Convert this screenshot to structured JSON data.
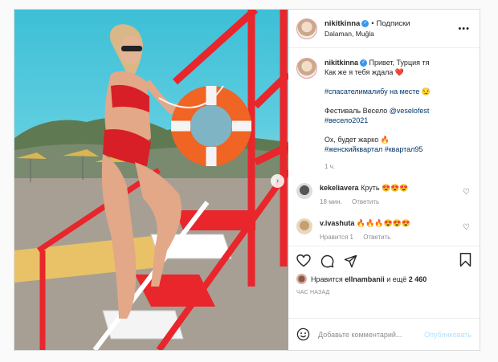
{
  "post": {
    "username": "nikitkinna",
    "follow_sep": "•",
    "follow_label": "Подписки",
    "location": "Dalaman, Muğla",
    "more_icon": "ellipsis-icon",
    "caption": {
      "line1": "Привет, Турция тя",
      "line2": "Как же я тебя ждала",
      "line2_emoji": "❤️",
      "tag1": "#спасателималибу на месте",
      "tag1_emoji": "😏",
      "fest": "Фестиваль Весело",
      "fest_handle": "@veselofest",
      "tag2": "#весело2021",
      "hot": "Ох, будет жарко",
      "hot_emoji": "🔥",
      "tags3": "#женскийквартал #квартал95"
    },
    "age": "1 ч.",
    "comments": [
      {
        "user": "kekeliavera",
        "text": "Круть 😍😍😍",
        "time": "18 мин.",
        "reply": "Ответить"
      },
      {
        "user": "v.ivashuta",
        "text": "🔥🔥🔥😍😍😍",
        "time": "Нравится 1",
        "reply": "Ответить"
      }
    ],
    "likes_prefix": "Нравится",
    "likes_user": "ellnambanii",
    "likes_suffix": "и ещё",
    "likes_count": "2 460",
    "timestamp": "ЧАС НАЗАД",
    "comment_placeholder": "Добавьте комментарий...",
    "publish_label": "Опубликовать",
    "next_arrow": "›"
  }
}
